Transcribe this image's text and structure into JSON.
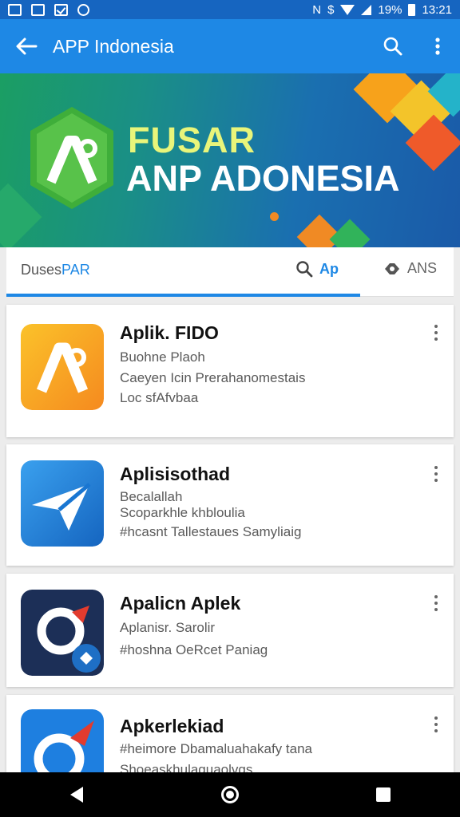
{
  "status_bar": {
    "battery_percent": "19%",
    "time": "13:21",
    "bt_glyph": "N",
    "dollar_glyph": "$"
  },
  "app_bar": {
    "title": "APP Indonesia",
    "back_icon": "arrow-left-icon",
    "search_icon": "search-icon",
    "more_icon": "more-vert-icon"
  },
  "banner": {
    "line1": "FUSAR",
    "line2": "ANP ADONESIA",
    "logo_color": "#3fae3a"
  },
  "tabs": {
    "left_label_plain": "Duses",
    "left_label_accent": "PAR",
    "search_label": "Ap",
    "ans_label": "ANS",
    "accent_color": "#1e88e5"
  },
  "apps": [
    {
      "title": "Aplik. FIDO",
      "lines": [
        "Buohne Plaoh",
        "Caeyen Icin Prerahanomestais",
        "Loc sfAfvbaa"
      ],
      "icon": "orange-a-app-icon"
    },
    {
      "title": "Aplisisothad",
      "lines": [
        "Becalallah",
        "Scoparkhle khbloulia",
        "#hcasnt Tallestaues Samyliaig"
      ],
      "icon": "paper-plane-app-icon"
    },
    {
      "title": "Apalicn Aplek",
      "lines": [
        "Aplanisr. Sarolir",
        "#hoshna OeRcet Paniag"
      ],
      "icon": "orbit-app-icon"
    },
    {
      "title": "Apkerlekiad",
      "lines": [
        "#heimore Dbamaluahakafy tana",
        "Shoeaskhulaguaolvgs"
      ],
      "icon": "rocket-app-icon"
    }
  ]
}
